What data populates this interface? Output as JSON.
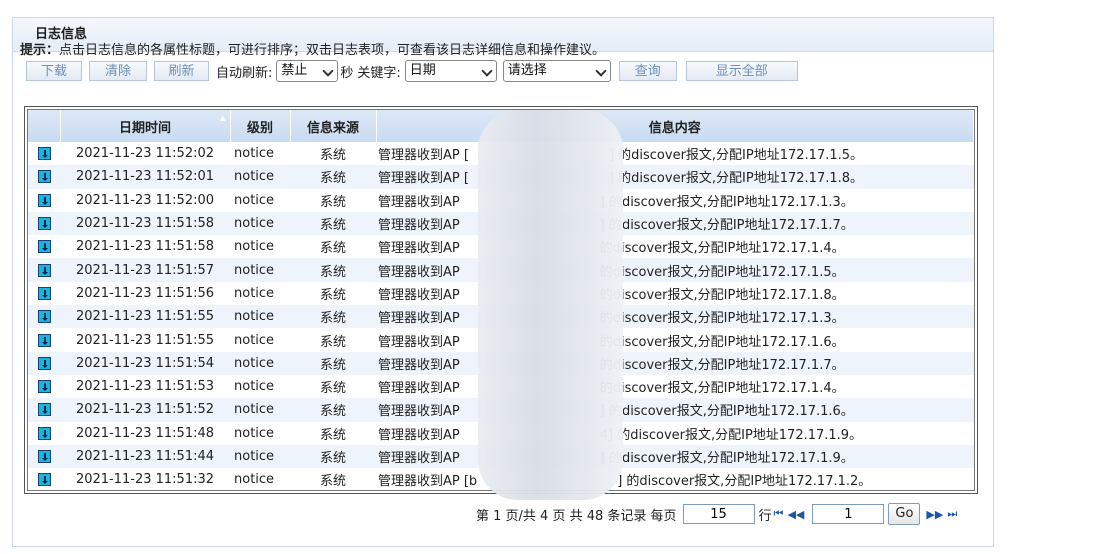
{
  "panel": {
    "title": "日志信息"
  },
  "hint": {
    "label": "提示：",
    "text": "点击日志信息的各属性标题，可进行排序；双击日志表项，可查看该日志详细信息和操作建议。"
  },
  "toolbar": {
    "download": "下载",
    "clear": "清除",
    "refresh": "刷新",
    "auto_refresh_label": "自动刷新:",
    "auto_refresh_value": "禁止",
    "seconds_label": "秒",
    "keyword_label": "关键字:",
    "keyword_field": "日期",
    "keyword_value": "请选择",
    "query": "查询",
    "show_all": "显示全部"
  },
  "table": {
    "headers": [
      "日期时间",
      "级别",
      "信息来源",
      "信息内容"
    ],
    "rows": [
      {
        "date": "2021-11-23 11:52:02",
        "level": "notice",
        "source": "系统",
        "pre": "管理器收到AP [",
        "post": "] 的discover报文,分配IP地址172.17.1.5。"
      },
      {
        "date": "2021-11-23 11:52:01",
        "level": "notice",
        "source": "系统",
        "pre": "管理器收到AP [",
        "post": "] 的discover报文,分配IP地址172.17.1.8。"
      },
      {
        "date": "2021-11-23 11:52:00",
        "level": "notice",
        "source": "系统",
        "pre": "管理器收到AP",
        "post": "] 的discover报文,分配IP地址172.17.1.3。"
      },
      {
        "date": "2021-11-23 11:51:58",
        "level": "notice",
        "source": "系统",
        "pre": "管理器收到AP",
        "post": "] 的discover报文,分配IP地址172.17.1.7。"
      },
      {
        "date": "2021-11-23 11:51:58",
        "level": "notice",
        "source": "系统",
        "pre": "管理器收到AP",
        "post": "的discover报文,分配IP地址172.17.1.4。"
      },
      {
        "date": "2021-11-23 11:51:57",
        "level": "notice",
        "source": "系统",
        "pre": "管理器收到AP",
        "post": "的discover报文,分配IP地址172.17.1.5。"
      },
      {
        "date": "2021-11-23 11:51:56",
        "level": "notice",
        "source": "系统",
        "pre": "管理器收到AP",
        "post": "的discover报文,分配IP地址172.17.1.8。"
      },
      {
        "date": "2021-11-23 11:51:55",
        "level": "notice",
        "source": "系统",
        "pre": "管理器收到AP",
        "post": "的discover报文,分配IP地址172.17.1.3。"
      },
      {
        "date": "2021-11-23 11:51:55",
        "level": "notice",
        "source": "系统",
        "pre": "管理器收到AP",
        "post": "的discover报文,分配IP地址172.17.1.6。"
      },
      {
        "date": "2021-11-23 11:51:54",
        "level": "notice",
        "source": "系统",
        "pre": "管理器收到AP",
        "post": "的discover报文,分配IP地址172.17.1.7。"
      },
      {
        "date": "2021-11-23 11:51:53",
        "level": "notice",
        "source": "系统",
        "pre": "管理器收到AP",
        "post": "的discover报文,分配IP地址172.17.1.4。"
      },
      {
        "date": "2021-11-23 11:51:52",
        "level": "notice",
        "source": "系统",
        "pre": "管理器收到AP",
        "post": "] 的discover报文,分配IP地址172.17.1.6。"
      },
      {
        "date": "2021-11-23 11:51:48",
        "level": "notice",
        "source": "系统",
        "pre": "管理器收到AP",
        "post": "4] 的discover报文,分配IP地址172.17.1.9。"
      },
      {
        "date": "2021-11-23 11:51:44",
        "level": "notice",
        "source": "系统",
        "pre": "管理器收到AP",
        "post": "] 的discover报文,分配IP地址172.17.1.9。"
      },
      {
        "date": "2021-11-23 11:51:32",
        "level": "notice",
        "source": "系统",
        "pre": "管理器收到AP [b",
        "post": "] 的discover报文,分配IP地址172.17.1.2。"
      }
    ]
  },
  "pager": {
    "summary": "第 1 页/共 4 页 共 48 条记录 每页",
    "per_page": "15",
    "row_label": "行",
    "page_value": "1",
    "go": "Go"
  }
}
